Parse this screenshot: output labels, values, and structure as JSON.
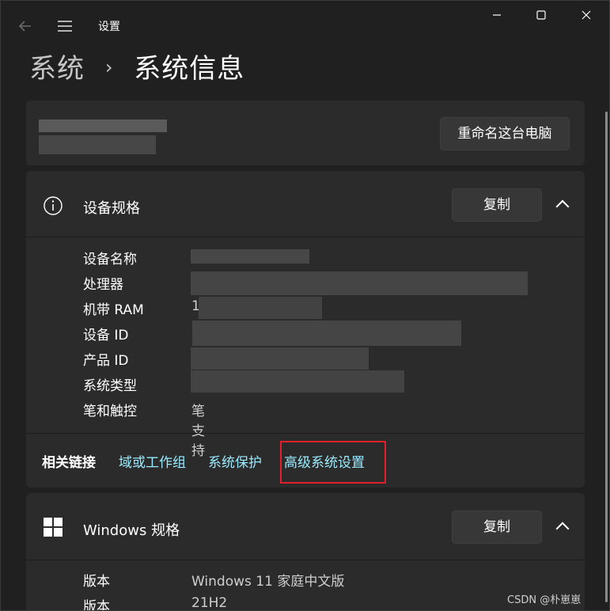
{
  "window": {
    "title": "设置",
    "back_icon": "back-arrow-icon",
    "menu_icon": "hamburger-icon",
    "minimize_icon": "minimize-icon",
    "maximize_icon": "maximize-icon",
    "close_icon": "close-icon"
  },
  "breadcrumb": {
    "parent": "系统",
    "separator": "›",
    "current": "系统信息"
  },
  "device_card": {
    "rename_button": "重命名这台电脑"
  },
  "device_specs": {
    "title": "设备规格",
    "copy_button": "复制",
    "rows": [
      {
        "label": "设备名称",
        "value": ""
      },
      {
        "label": "处理器",
        "value": ""
      },
      {
        "label": "机带 RAM",
        "value": "1"
      },
      {
        "label": "设备 ID",
        "value": ""
      },
      {
        "label": "产品 ID",
        "value": ""
      },
      {
        "label": "系统类型",
        "value": ""
      },
      {
        "label": "笔和触控",
        "value": "笔支持"
      }
    ]
  },
  "related_links": {
    "label": "相关链接",
    "links": [
      "域或工作组",
      "系统保护",
      "高级系统设置"
    ],
    "highlighted_index": 2
  },
  "windows_specs": {
    "title": "Windows 规格",
    "copy_button": "复制",
    "rows": [
      {
        "label": "版本",
        "value": "Windows 11 家庭中文版"
      },
      {
        "label": "版本",
        "value": "21H2"
      }
    ]
  },
  "watermark": "CSDN @朴崽崽",
  "colors": {
    "accent_link": "#99ebff",
    "highlight_box": "#e0202a",
    "background": "#202020",
    "card": "#2b2b2b"
  }
}
